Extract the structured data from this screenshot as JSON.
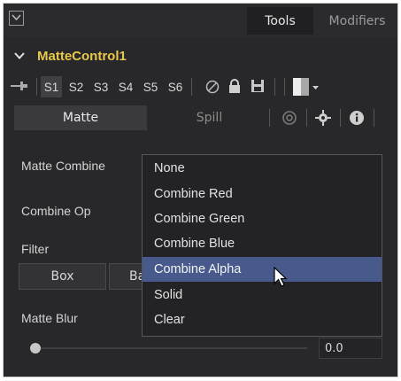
{
  "tabs": {
    "tools": "Tools",
    "modifiers": "Modifiers"
  },
  "node": {
    "title": "MatteControl1"
  },
  "toolbar": {
    "scripts": [
      "S1",
      "S2",
      "S3",
      "S4",
      "S5",
      "S6"
    ]
  },
  "subtabs": {
    "matte": "Matte",
    "spill": "Spill"
  },
  "labels": {
    "matte_combine": "Matte Combine",
    "combine_op": "Combine Op",
    "filter": "Filter",
    "matte_blur": "Matte Blur"
  },
  "filter_buttons": {
    "box": "Box",
    "partial": "Ba"
  },
  "matte_blur": {
    "value": "0.0"
  },
  "dropdown": {
    "options": [
      "None",
      "Combine Red",
      "Combine Green",
      "Combine Blue",
      "Combine Alpha",
      "Solid",
      "Clear"
    ],
    "highlighted": "Combine Alpha"
  },
  "colors": {
    "accent_title": "#e8c84a",
    "highlight": "#485a8c"
  }
}
